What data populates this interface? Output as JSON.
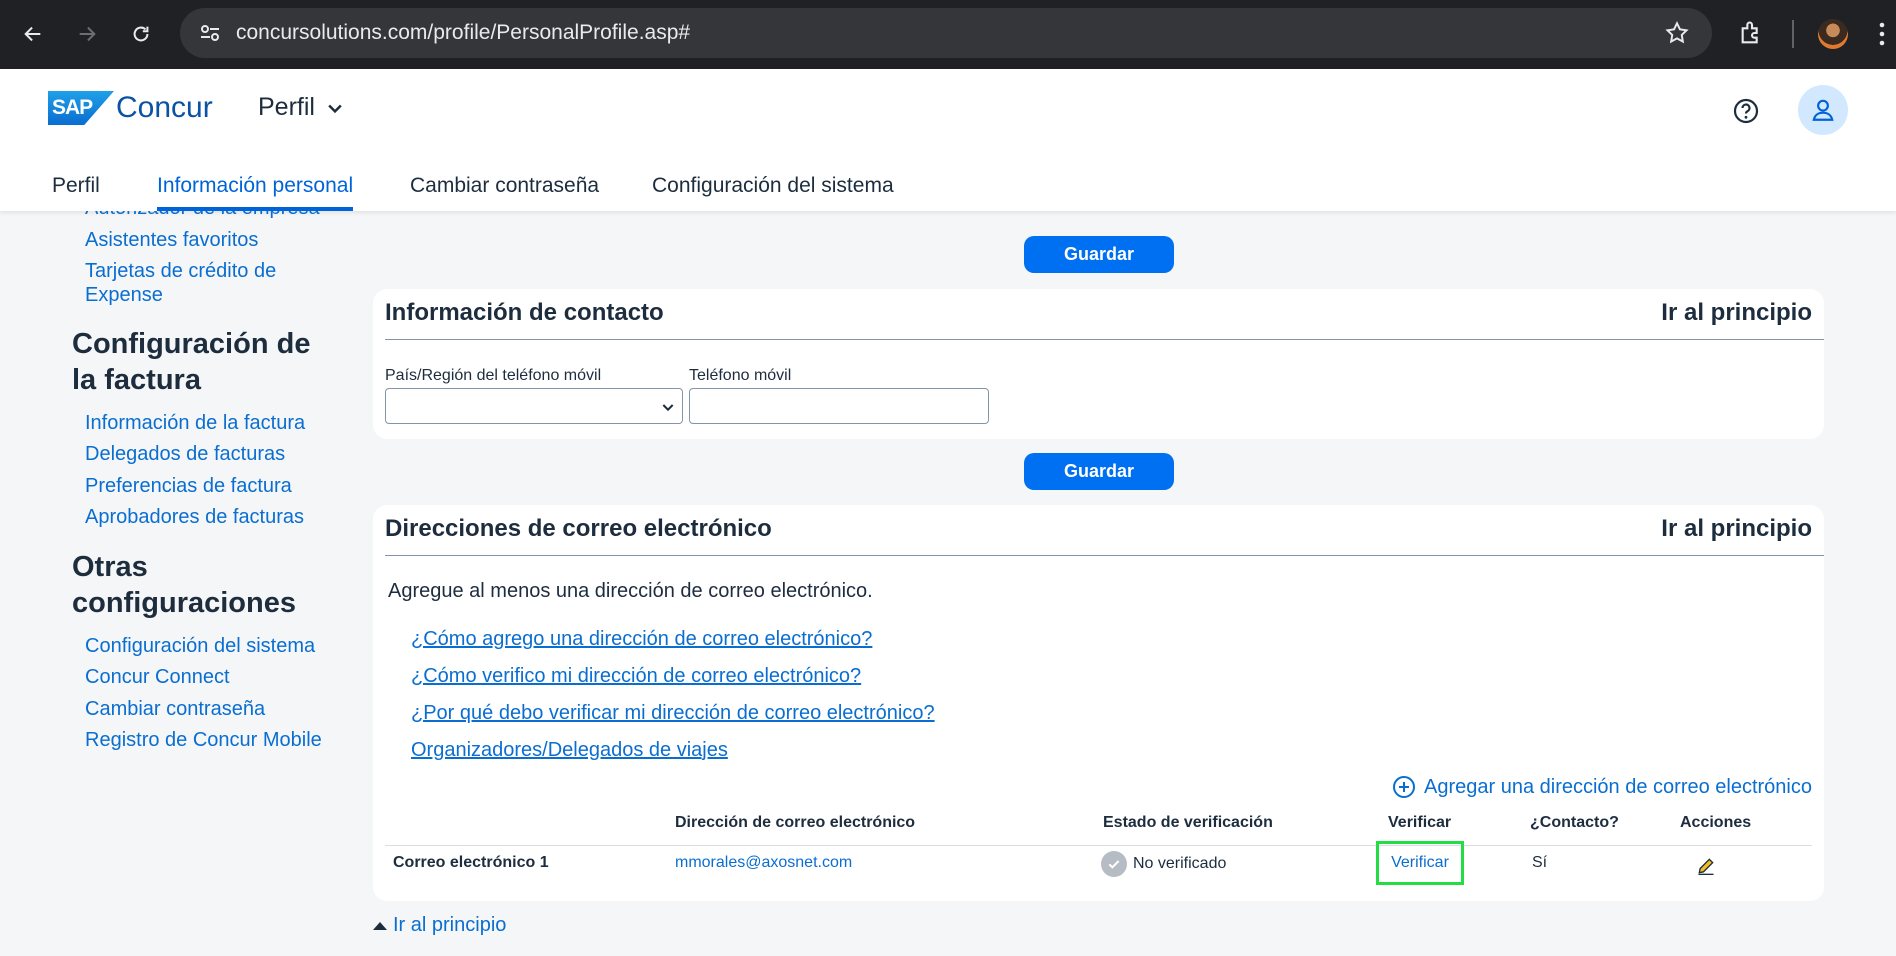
{
  "browser": {
    "url": "concursolutions.com/profile/PersonalProfile.asp#"
  },
  "header": {
    "logo_badge": "SAP",
    "logo_text": "Concur",
    "module": "Perfil",
    "tabs": [
      {
        "label": "Perfil"
      },
      {
        "label": "Información personal"
      },
      {
        "label": "Cambiar contraseña"
      },
      {
        "label": "Configuración del sistema"
      }
    ]
  },
  "sidebar": {
    "partial_link": "Autorizador de la empresa",
    "links_top": [
      {
        "label": "Asistentes favoritos"
      },
      {
        "label": "Tarjetas de crédito de"
      },
      {
        "label": "Expense"
      }
    ],
    "section_invoice": {
      "heading_line1": "Configuración de",
      "heading_line2": "la factura",
      "links": [
        {
          "label": "Información de la factura"
        },
        {
          "label": "Delegados de facturas"
        },
        {
          "label": "Preferencias de factura"
        },
        {
          "label": "Aprobadores de facturas"
        }
      ]
    },
    "section_other": {
      "heading_line1": "Otras",
      "heading_line2": "configuraciones",
      "links": [
        {
          "label": "Configuración del sistema"
        },
        {
          "label": "Concur Connect"
        },
        {
          "label": "Cambiar contraseña"
        },
        {
          "label": "Registro de Concur Mobile"
        }
      ]
    }
  },
  "main": {
    "save_label": "Guardar",
    "contact": {
      "title": "Información de contacto",
      "top_link": "Ir al principio",
      "country_label": "País/Región del teléfono móvil",
      "country_value": "",
      "phone_label": "Teléfono móvil",
      "phone_value": ""
    },
    "emails": {
      "title": "Direcciones de correo electrónico",
      "top_link": "Ir al principio",
      "intro": "Agregue al menos una dirección de correo electrónico.",
      "help_links": [
        {
          "label": "¿Cómo agrego una dirección de correo electrónico?"
        },
        {
          "label": "¿Cómo verifico mi dirección de correo electrónico?"
        },
        {
          "label": "¿Por qué debo verificar mi dirección de correo electrónico?"
        },
        {
          "label": "Organizadores/Delegados de viajes"
        }
      ],
      "add_label": "Agregar una dirección de correo electrónico",
      "columns": {
        "address": "Dirección de correo electrónico",
        "status": "Estado de verificación",
        "verify": "Verificar",
        "contact": "¿Contacto?",
        "actions": "Acciones"
      },
      "rows": [
        {
          "name": "Correo electrónico 1",
          "address": "mmorales@axosnet.com",
          "status": "No verificado",
          "verify": "Verificar",
          "contact": "Sí"
        }
      ]
    },
    "back_to_top": "Ir al principio"
  },
  "colors": {
    "accent": "#0070f2",
    "link": "#0a6ed1",
    "highlight": "#22dd44"
  }
}
